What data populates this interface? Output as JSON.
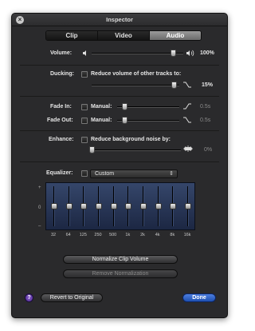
{
  "window": {
    "title": "Inspector"
  },
  "tabs": [
    {
      "label": "Clip",
      "active": false
    },
    {
      "label": "Video",
      "active": false
    },
    {
      "label": "Audio",
      "active": true
    }
  ],
  "volume": {
    "label": "Volume:",
    "value": "100%",
    "level": 0.89
  },
  "ducking": {
    "label": "Ducking:",
    "checkbox_label": "Reduce volume of other tracks to:",
    "value": "15%",
    "level": 0.94
  },
  "fade_in": {
    "label": "Fade In:",
    "manual_label": "Manual:",
    "value": "0.5s",
    "level": 0.12
  },
  "fade_out": {
    "label": "Fade Out:",
    "manual_label": "Manual:",
    "value": "0.5s",
    "level": 0.12
  },
  "enhance": {
    "label": "Enhance:",
    "checkbox_label": "Reduce background noise by:",
    "value": "0%",
    "level": 0.0
  },
  "equalizer": {
    "label": "Equalizer:",
    "preset": "Custom",
    "scale": {
      "top": "+",
      "mid": "0",
      "bottom": "–"
    },
    "bands": [
      "32",
      "64",
      "125",
      "250",
      "500",
      "1k",
      "2k",
      "4k",
      "8k",
      "16k"
    ]
  },
  "buttons": {
    "normalize": "Normalize Clip Volume",
    "remove_normalization": "Remove Normalization",
    "revert": "Revert to Original",
    "done": "Done",
    "help": "?"
  },
  "colors": {
    "panel": "#2a2a2c",
    "eq_bg": "#2a3a5e",
    "done": "#2f63cf",
    "help": "#6b45b0"
  }
}
